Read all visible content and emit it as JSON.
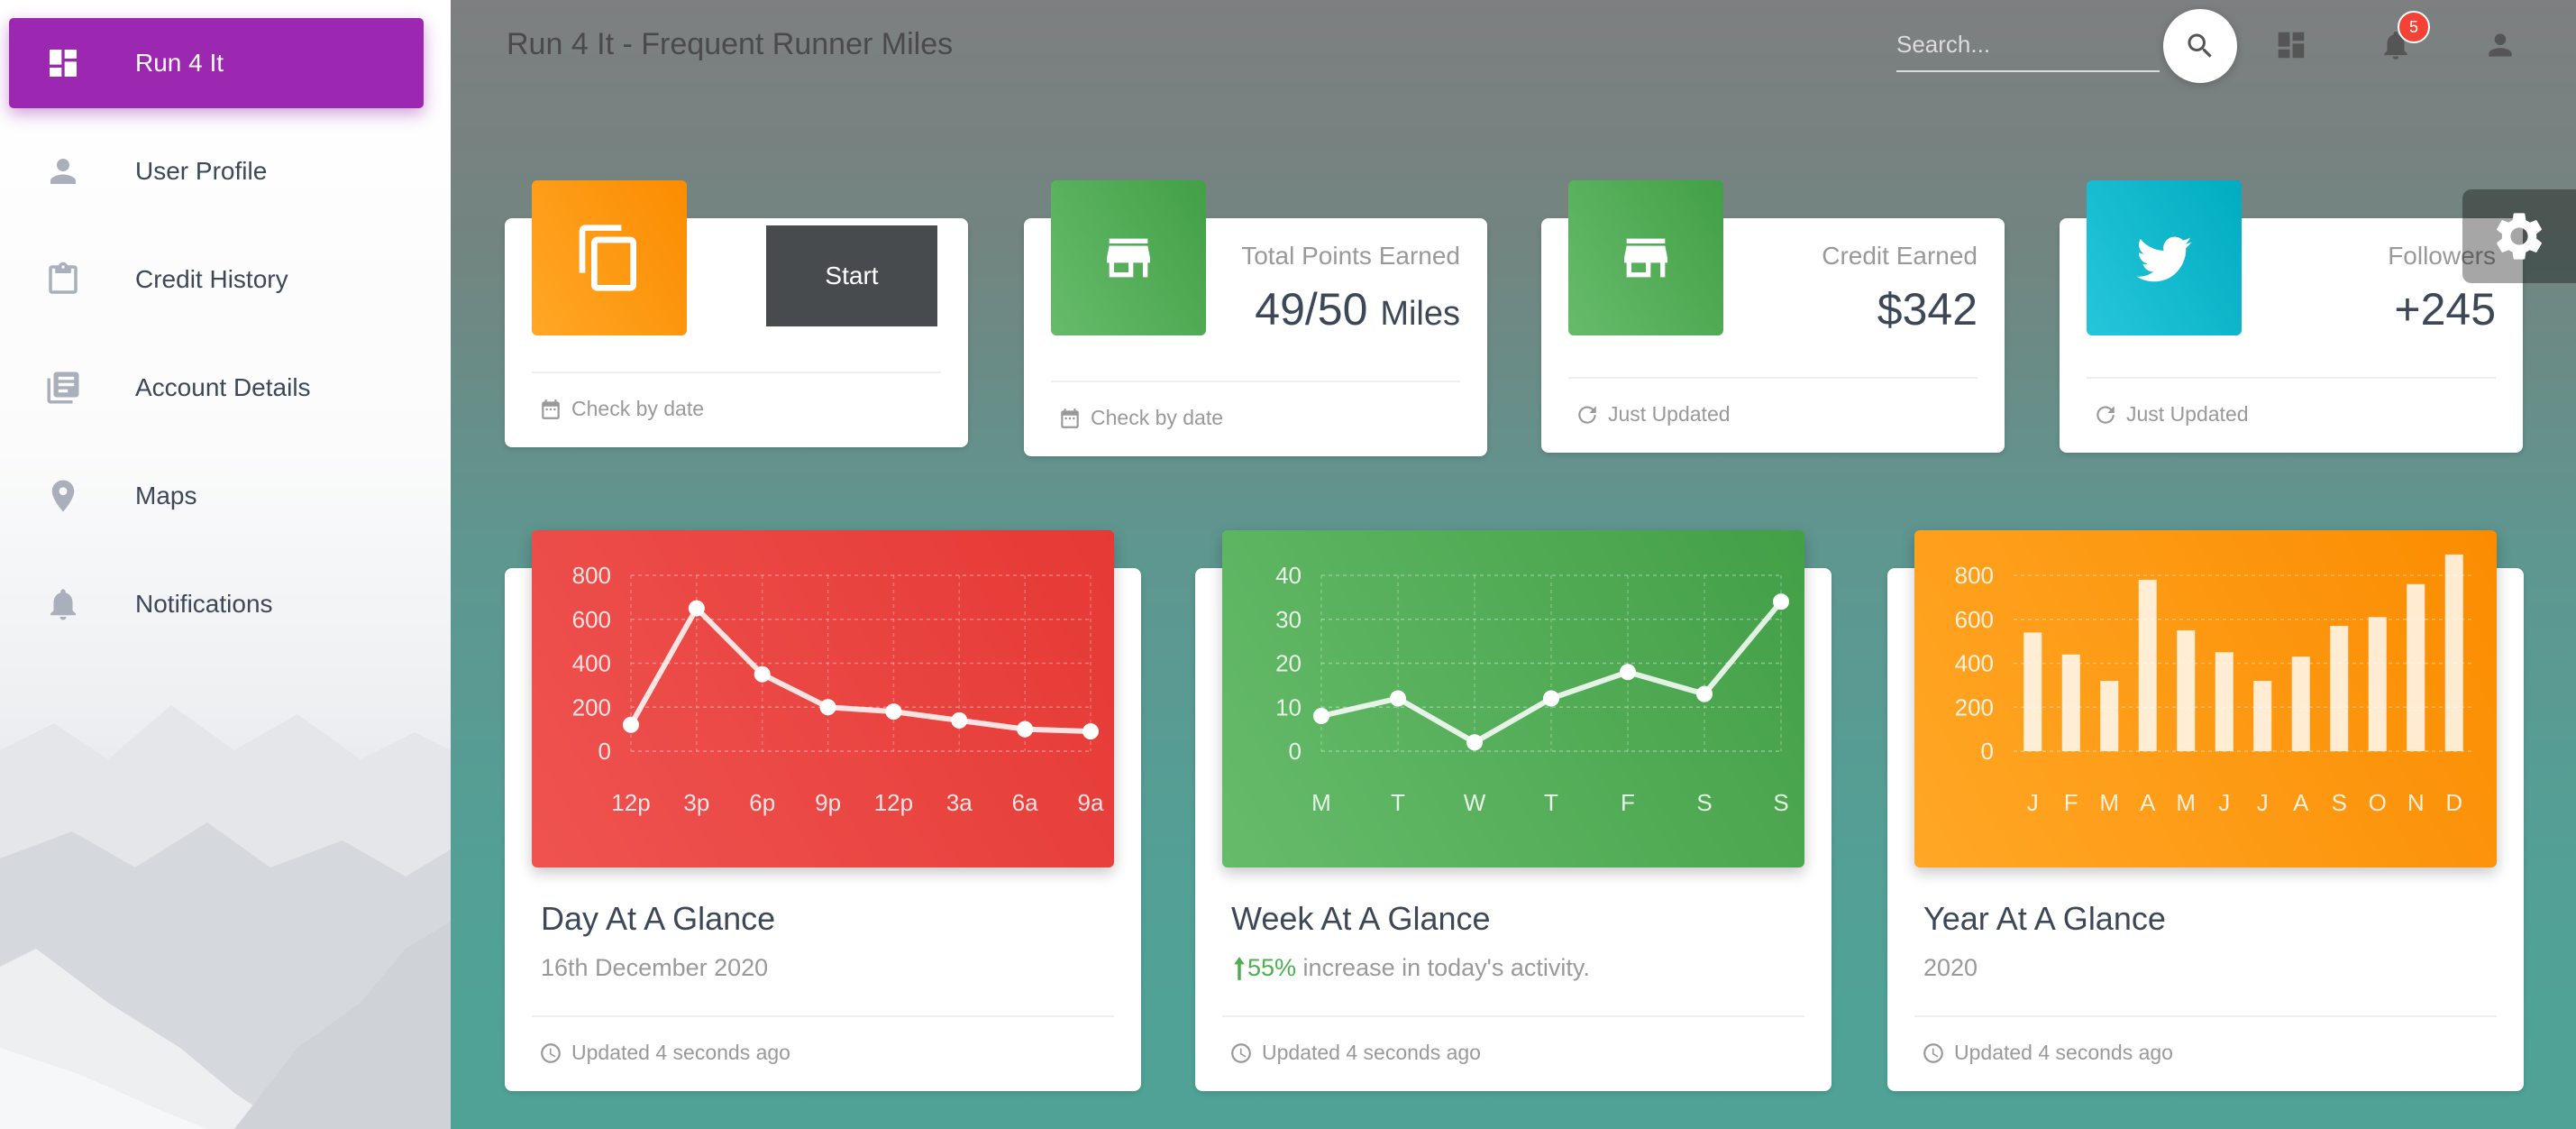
{
  "sidebar": {
    "items": [
      {
        "label": "Run 4 It",
        "icon": "dashboard-icon"
      },
      {
        "label": "User Profile",
        "icon": "person-icon"
      },
      {
        "label": "Credit History",
        "icon": "clipboard-icon"
      },
      {
        "label": "Account Details",
        "icon": "library-books-icon"
      },
      {
        "label": "Maps",
        "icon": "location-pin-icon"
      },
      {
        "label": "Notifications",
        "icon": "bell-icon"
      }
    ],
    "active_color": "#9c27b0"
  },
  "header": {
    "title": "Run 4 It - Frequent Runner Miles",
    "search_placeholder": "Search...",
    "notification_count": "5"
  },
  "stats": [
    {
      "button": "Start",
      "footer": "Check by date",
      "icon": "copy-icon",
      "color": "#ff9800"
    },
    {
      "category": "Total Points Earned",
      "value": "49/50",
      "unit": "Miles",
      "footer": "Check by date",
      "icon": "store-icon",
      "color": "#4caf50"
    },
    {
      "category": "Credit Earned",
      "value": "$342",
      "footer": "Just Updated",
      "icon": "store-icon",
      "color": "#4caf50"
    },
    {
      "category": "Followers",
      "value": "+245",
      "footer": "Just Updated",
      "icon": "twitter-icon",
      "color": "#00bcd4"
    }
  ],
  "charts": [
    {
      "title": "Day At A Glance",
      "subtitle": "16th December 2020",
      "footer": "Updated 4 seconds ago"
    },
    {
      "title": "Week At A Glance",
      "subtitle_pct": "55%",
      "subtitle_rest": " increase in today's activity.",
      "footer": "Updated 4 seconds ago"
    },
    {
      "title": "Year At A Glance",
      "subtitle": "2020",
      "footer": "Updated 4 seconds ago"
    }
  ],
  "chart_data": [
    {
      "type": "line",
      "categories": [
        "12p",
        "3p",
        "6p",
        "9p",
        "12p",
        "3a",
        "6a",
        "9a"
      ],
      "values": [
        120,
        650,
        350,
        200,
        180,
        140,
        100,
        90
      ],
      "yticks": [
        0,
        200,
        400,
        600,
        800
      ],
      "ylim": [
        0,
        800
      ],
      "color": "#e53935"
    },
    {
      "type": "line",
      "categories": [
        "M",
        "T",
        "W",
        "T",
        "F",
        "S",
        "S"
      ],
      "values": [
        8,
        12,
        2,
        12,
        18,
        13,
        34
      ],
      "yticks": [
        0,
        10,
        20,
        30,
        40
      ],
      "ylim": [
        0,
        40
      ],
      "color": "#43a047"
    },
    {
      "type": "bar",
      "categories": [
        "J",
        "F",
        "M",
        "A",
        "M",
        "J",
        "J",
        "A",
        "S",
        "O",
        "N",
        "D"
      ],
      "values": [
        540,
        440,
        320,
        780,
        550,
        450,
        320,
        430,
        570,
        610,
        760,
        895
      ],
      "yticks": [
        0,
        200,
        400,
        600,
        800
      ],
      "ylim": [
        0,
        800
      ],
      "color": "#fb8c00"
    }
  ]
}
